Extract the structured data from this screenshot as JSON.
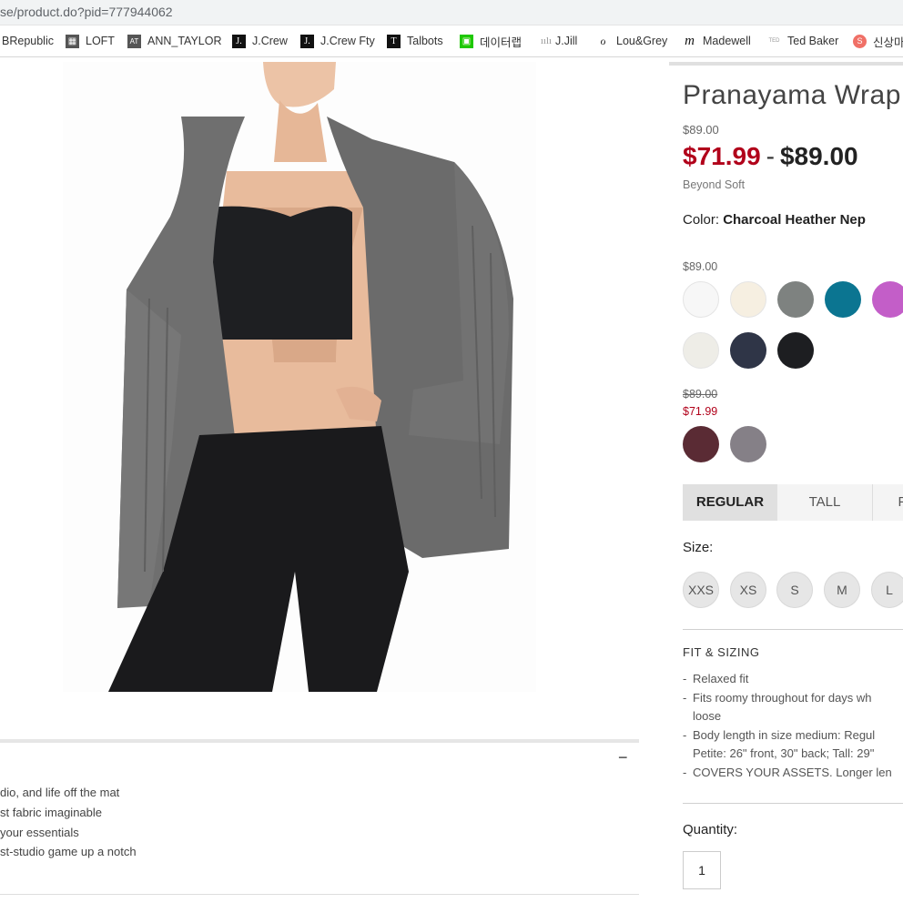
{
  "browser": {
    "url": "se/product.do?pid=777944062",
    "bookmarks": [
      {
        "label": "BRepublic",
        "icon": "none"
      },
      {
        "label": "LOFT",
        "icon": "loft-icon"
      },
      {
        "label": "ANN_TAYLOR",
        "icon": "at-icon"
      },
      {
        "label": "J.Crew",
        "icon": "jcrew-icon"
      },
      {
        "label": "J.Crew Fty",
        "icon": "jcrew-factory-icon"
      },
      {
        "label": "Talbots",
        "icon": "talbots-icon"
      },
      {
        "label": "데이터랩",
        "icon": "datalab-icon"
      },
      {
        "label": "J.Jill",
        "icon": "jjill-icon"
      },
      {
        "label": "Lou&Grey",
        "icon": "lougrey-icon"
      },
      {
        "label": "Madewell",
        "icon": "madewell-icon"
      },
      {
        "label": "Ted Baker",
        "icon": "tedbaker-icon"
      },
      {
        "label": "신상마",
        "icon": "sinsangma-icon"
      }
    ]
  },
  "product": {
    "title": "Pranayama Wrap",
    "original_price": "$89.00",
    "sale_price": "$71.99",
    "price_dash": "-",
    "regular_price": "$89.00",
    "collection": "Beyond Soft",
    "color_label": "Color:",
    "color_value": "Charcoal Heather Nep",
    "swatch_groups": [
      {
        "price": "$89.00",
        "colors": [
          "#f7f7f7",
          "#f6efe1",
          "#7e8280",
          "#0b7591",
          "#c35ec8",
          "#eeede7",
          "#2f3547",
          "#1d1e21"
        ]
      },
      {
        "was": "$89.00",
        "now": "$71.99",
        "colors": [
          "#5a2b34",
          "#858087"
        ]
      }
    ],
    "fit_tabs": [
      "REGULAR",
      "TALL",
      "P"
    ],
    "size_label": "Size:",
    "sizes": [
      "XXS",
      "XS",
      "S",
      "M",
      "L"
    ],
    "fit_heading": "FIT & SIZING",
    "fit_bullet_marker": "-",
    "fit_items": [
      "Relaxed fit",
      "Fits roomy throughout for days wh",
      "loose",
      "Body length in size medium: Regul",
      "Petite: 26\" front, 30\" back; Tall: 29\"",
      "COVERS YOUR ASSETS. Longer len"
    ],
    "quantity_label": "Quantity:",
    "quantity": "1"
  },
  "details": {
    "toggle": "−",
    "bullets": [
      "dio, and life off the mat",
      "st fabric imaginable",
      "your essentials",
      "st-studio game up a notch"
    ]
  }
}
